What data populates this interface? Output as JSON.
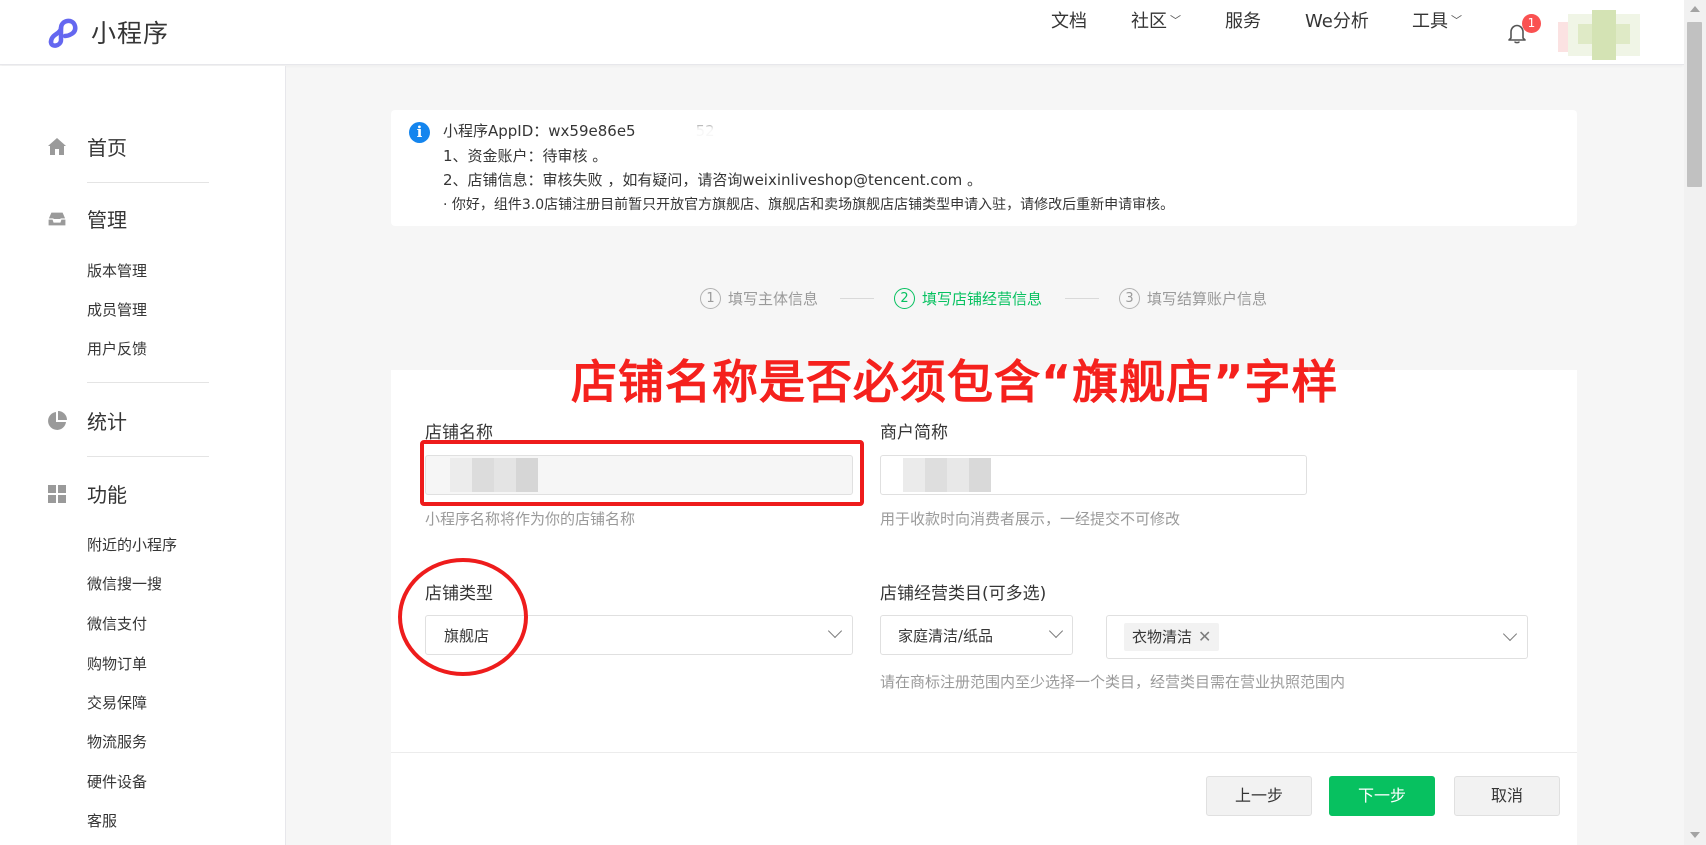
{
  "header": {
    "app_title": "小程序",
    "nav": [
      {
        "label": "文档",
        "dropdown": false
      },
      {
        "label": "社区",
        "dropdown": true
      },
      {
        "label": "服务",
        "dropdown": false
      },
      {
        "label": "We分析",
        "dropdown": false
      },
      {
        "label": "工具",
        "dropdown": true
      }
    ],
    "notification_count": "1",
    "dropdown_glyph": "﹀"
  },
  "sidebar": {
    "sections": [
      {
        "label": "首页",
        "icon": "home-icon"
      },
      {
        "label": "管理",
        "icon": "inbox-icon",
        "items": [
          "版本管理",
          "成员管理",
          "用户反馈"
        ]
      },
      {
        "label": "统计",
        "icon": "pie-chart-icon"
      },
      {
        "label": "功能",
        "icon": "grid-icon",
        "items": [
          "附近的小程序",
          "微信搜一搜",
          "微信支付",
          "购物订单",
          "交易保障",
          "物流服务",
          "硬件设备",
          "客服"
        ]
      }
    ]
  },
  "notice": {
    "icon": "i",
    "appid_line": "小程序AppID：wx59e86e5",
    "appid_suffix": "52",
    "line1": "1、资金账户：待审核 。",
    "line2": "2、店铺信息：审核失败 ，如有疑问，请咨询weixinliveshop@tencent.com 。",
    "line3": "· 你好，组件3.0店铺注册目前暂只开放官方旗舰店、旗舰店和卖场旗舰店店铺类型申请入驻，请修改后重新申请审核。"
  },
  "steps": [
    {
      "num": "1",
      "label": "填写主体信息",
      "active": false
    },
    {
      "num": "2",
      "label": "填写店铺经营信息",
      "active": true
    },
    {
      "num": "3",
      "label": "填写结算账户信息",
      "active": false
    }
  ],
  "annotation": "店铺名称是否必须包含“旗舰店”字样",
  "form": {
    "shop_name": {
      "label": "店铺名称",
      "hint": "小程序名称将作为你的店铺名称"
    },
    "merchant_short": {
      "label": "商户简称",
      "hint": "用于收款时向消费者展示，一经提交不可修改"
    },
    "shop_type": {
      "label": "店铺类型",
      "value": "旗舰店"
    },
    "categories": {
      "label": "店铺经营类目(可多选)",
      "primary_value": "家庭清洁/纸品",
      "tag": "衣物清洁",
      "tag_remove": "✕",
      "hint": "请在商标注册范围内至少选择一个类目，经营类目需在营业执照范围内"
    }
  },
  "buttons": {
    "prev": "上一步",
    "next": "下一步",
    "cancel": "取消"
  },
  "colors": {
    "accent": "#07c160",
    "annotation": "#f5211d",
    "info": "#1485ee",
    "badge": "#fa5151"
  }
}
